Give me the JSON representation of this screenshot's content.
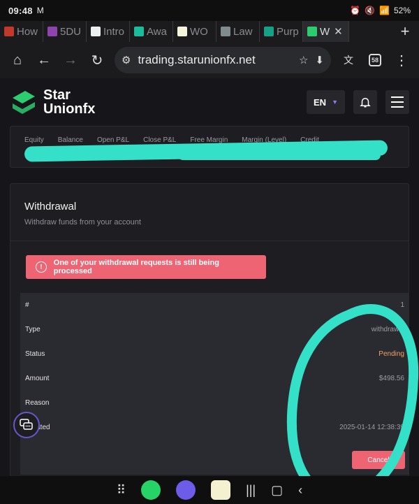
{
  "status_bar": {
    "time": "09:48",
    "mail_icon": "M",
    "battery": "52%"
  },
  "tabs": [
    {
      "label": "How",
      "color": "#c0392b"
    },
    {
      "label": "5DU",
      "color": "#8e44ad"
    },
    {
      "label": "Intro",
      "color": "#ecf0f1"
    },
    {
      "label": "Awa",
      "color": "#1abc9c"
    },
    {
      "label": "WO",
      "color": "#f5f5dc"
    },
    {
      "label": "Law",
      "color": "#7f8c8d"
    },
    {
      "label": "Purp",
      "color": "#16a085"
    },
    {
      "label": "W",
      "color": "#2ecc71",
      "active": true
    }
  ],
  "browser": {
    "url": "trading.starunionfx.net",
    "tab_count": "58"
  },
  "site": {
    "logo_line1": "Star",
    "logo_line2": "Unionfx",
    "lang": "EN"
  },
  "summary_labels": [
    "Equity",
    "Balance",
    "Open P&L",
    "Close P&L",
    "Free Margin",
    "Margin (Level)",
    "Credit"
  ],
  "withdrawal": {
    "title": "Withdrawal",
    "subtitle": "Withdraw funds from your account",
    "alert": "One of your withdrawal requests is still being processed",
    "rows": [
      {
        "key": "#",
        "value": "1"
      },
      {
        "key": "Type",
        "value": "withdrawal"
      },
      {
        "key": "Status",
        "value": "Pending"
      },
      {
        "key": "Amount",
        "value": "$498.56"
      },
      {
        "key": "Reason",
        "value": ""
      },
      {
        "key": "Created",
        "value": "2025-01-14 12:38:39"
      }
    ],
    "cancel_label": "Cancel"
  },
  "colors": {
    "accent": "#ef6473",
    "pending": "#f4a261",
    "logo_green": "#2ecc71",
    "scribble": "#35e0c9"
  }
}
